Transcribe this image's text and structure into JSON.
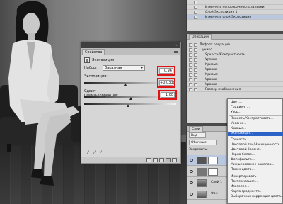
{
  "properties": {
    "tab": "Свойства",
    "title": "Экспозиция",
    "preset_label": "Набор:",
    "preset_value": "Заказная",
    "exposure_label": "Экспозиция:",
    "exposure_value": "0,96",
    "offset_label": "Сдвиг:",
    "offset_value": "+0,0330",
    "gamma_label": "Гамма-коррекция:",
    "gamma_value": "1,00"
  },
  "history": {
    "items": [
      {
        "label": ""
      },
      {
        "label": "Изменить непрозрачность заливки"
      },
      {
        "label": "Слой Экспозиция 1"
      },
      {
        "label": "Изменить слой Экспозиция"
      }
    ]
  },
  "actions": {
    "tab": "Операции",
    "items": [
      {
        "label": "Дефолт операций"
      },
      {
        "label": "уникс"
      },
      {
        "label": "Яркость/Контрастность"
      },
      {
        "label": "Уровни"
      },
      {
        "label": "Кривые"
      },
      {
        "label": "Уровни"
      },
      {
        "label": "Кривые"
      },
      {
        "label": "Уровни"
      },
      {
        "label": "Уровни"
      },
      {
        "label": "Размер изображения"
      }
    ]
  },
  "layers": {
    "tab": "Слои",
    "kind": "Вид",
    "blend": "Обычные",
    "lock_label": "Закрепить:",
    "rows": [
      {
        "name": ""
      },
      {
        "name": ""
      },
      {
        "name": "Слой 1"
      },
      {
        "name": "Фон"
      }
    ]
  },
  "menu": {
    "items": [
      {
        "label": "Цвет..."
      },
      {
        "label": "Градиент..."
      },
      {
        "label": "Узор..."
      },
      {
        "label": "Яркость/Контрастность..."
      },
      {
        "label": "Уровни..."
      },
      {
        "label": "Кривые..."
      },
      {
        "label": "Экспозиция..."
      },
      {
        "label": "Сочность..."
      },
      {
        "label": "Цветовой тон/Насыщенность..."
      },
      {
        "label": "Цветовой баланс..."
      },
      {
        "label": "Черно-белое..."
      },
      {
        "label": "Фотофильтр..."
      },
      {
        "label": "Микширование каналов..."
      },
      {
        "label": "Поиск цвета..."
      },
      {
        "label": "Инвертировать"
      },
      {
        "label": "Постеризация..."
      },
      {
        "label": "Изогелия..."
      },
      {
        "label": "Карта градиента..."
      },
      {
        "label": "Выборочная коррекция цвета..."
      }
    ],
    "active_index": 6
  },
  "colors": {
    "highlight": "#e01414",
    "menu_selection": "#2b62c8"
  }
}
